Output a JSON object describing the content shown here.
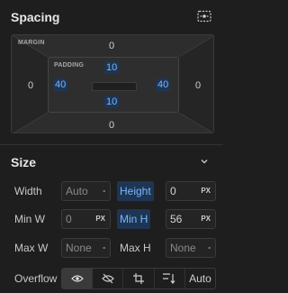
{
  "spacing": {
    "title": "Spacing",
    "margin_label": "MARGIN",
    "margin": {
      "top": "0",
      "right": "0",
      "bottom": "0",
      "left": "0"
    },
    "padding_label": "PADDING",
    "padding": {
      "top": "10",
      "right": "40",
      "bottom": "10",
      "left": "40"
    }
  },
  "size": {
    "title": "Size",
    "rows": {
      "width": {
        "label": "Width",
        "value": "Auto",
        "unit": "-"
      },
      "height": {
        "label": "Height",
        "value": "0",
        "unit": "PX"
      },
      "min_w": {
        "label": "Min W",
        "value": "0",
        "unit": "PX"
      },
      "min_h": {
        "label": "Min H",
        "value": "56",
        "unit": "PX"
      },
      "max_w": {
        "label": "Max W",
        "value": "None",
        "unit": "-"
      },
      "max_h": {
        "label": "Max H",
        "value": "None",
        "unit": "-"
      }
    },
    "overflow": {
      "label": "Overflow",
      "options": [
        {
          "icon": "eye-icon",
          "selected": true
        },
        {
          "icon": "eye-off-icon",
          "selected": false
        },
        {
          "icon": "crop-icon",
          "selected": false
        },
        {
          "icon": "scroll-icon",
          "selected": false
        },
        {
          "text": "Auto",
          "selected": false
        }
      ]
    }
  },
  "colors": {
    "accent": "#79b7ff",
    "accent_bg": "#1e3553",
    "panel_bg": "#1e1e1e"
  }
}
